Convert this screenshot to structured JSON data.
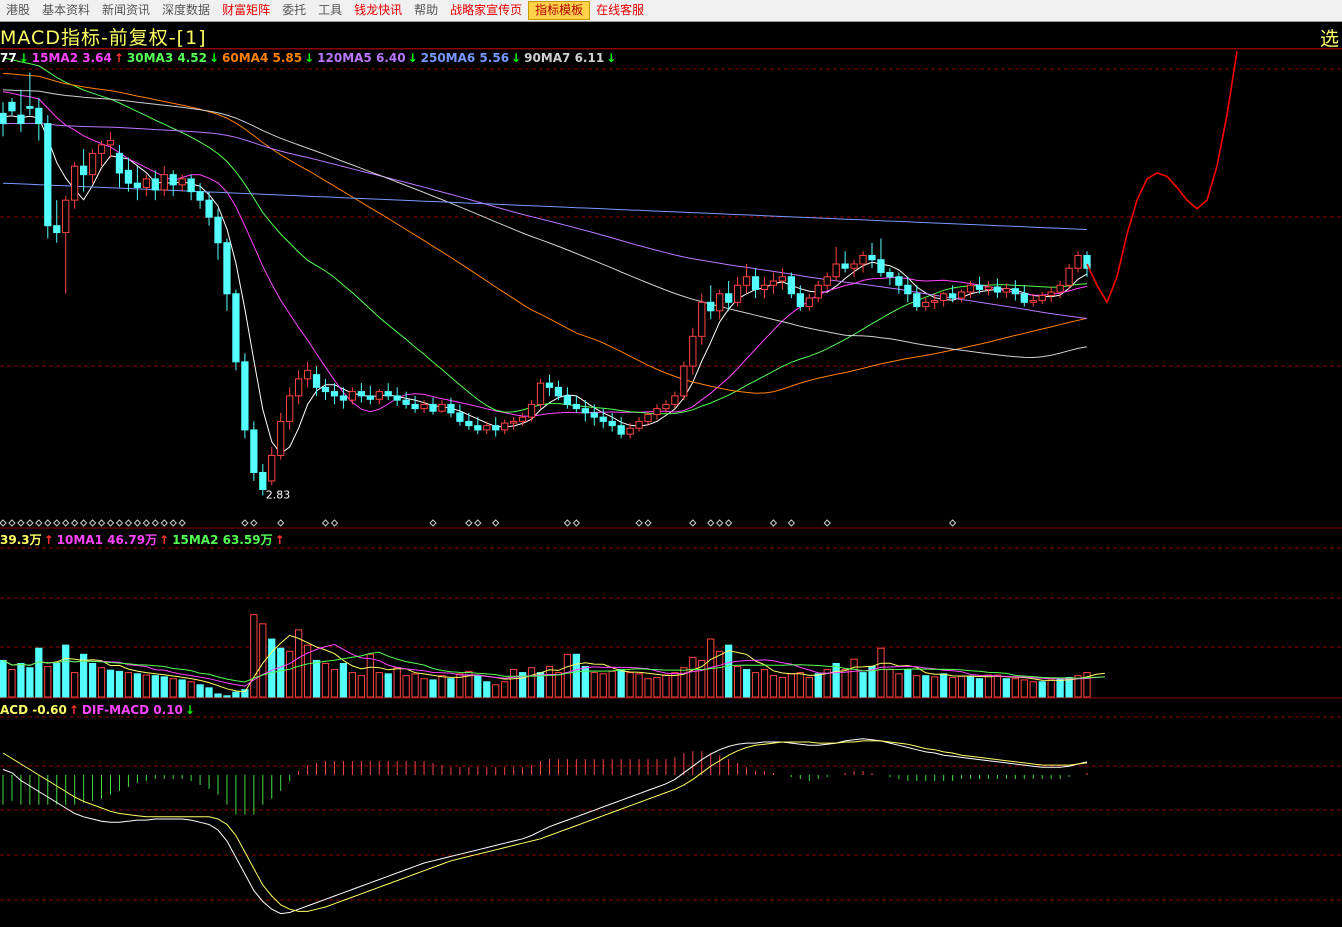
{
  "menu": [
    {
      "label": "港股",
      "style": "normal"
    },
    {
      "label": "基本资料",
      "style": "normal"
    },
    {
      "label": "新闻资讯",
      "style": "normal"
    },
    {
      "label": "深度数据",
      "style": "normal"
    },
    {
      "label": "财富矩阵",
      "style": "red"
    },
    {
      "label": "委托",
      "style": "normal"
    },
    {
      "label": "工具",
      "style": "normal"
    },
    {
      "label": "钱龙快讯",
      "style": "red"
    },
    {
      "label": "帮助",
      "style": "normal"
    },
    {
      "label": "战略家宣传页",
      "style": "red"
    },
    {
      "label": "指标模板",
      "style": "active"
    },
    {
      "label": "在线客服",
      "style": "red"
    }
  ],
  "title": "MACD指标-前复权-[1]",
  "select_label": "选",
  "ma_legend": [
    {
      "text": "77",
      "color": "#ffffff",
      "arrow": "↓",
      "arrow_color": "#00ff00"
    },
    {
      "text": "15MA2 3.64",
      "color": "#ff44ff",
      "arrow": "↑",
      "arrow_color": "#ff3333"
    },
    {
      "text": "30MA3 4.52",
      "color": "#55ff55",
      "arrow": "↓",
      "arrow_color": "#00ff00"
    },
    {
      "text": "60MA4 5.85",
      "color": "#ff8000",
      "arrow": "↓",
      "arrow_color": "#00ff00"
    },
    {
      "text": "120MA5 6.40",
      "color": "#bb77ff",
      "arrow": "↓",
      "arrow_color": "#00ff00"
    },
    {
      "text": "250MA6 5.56",
      "color": "#7799ff",
      "arrow": "↓",
      "arrow_color": "#00ff00"
    },
    {
      "text": "90MA7 6.11",
      "color": "#d0d0d0",
      "arrow": "↓",
      "arrow_color": "#00ff00"
    }
  ],
  "vol_legend": [
    {
      "text": "39.3万",
      "color": "#ffff66",
      "arrow": "↑",
      "arrow_color": "#ff3333"
    },
    {
      "text": "10MA1 46.79万",
      "color": "#ff44ff",
      "arrow": "↑",
      "arrow_color": "#ff3333"
    },
    {
      "text": "15MA2 63.59万",
      "color": "#55ff55",
      "arrow": "↑",
      "arrow_color": "#ff3333"
    }
  ],
  "macd_legend": [
    {
      "text": "ACD -0.60",
      "color": "#ffff66",
      "arrow": "↑",
      "arrow_color": "#ff3333"
    },
    {
      "text": "DIF-MACD 0.10",
      "color": "#ff44ff",
      "arrow": "↓",
      "arrow_color": "#00ff00"
    }
  ],
  "low_label": "2.83",
  "colors": {
    "up": "#ff4444",
    "down": "#54ffff",
    "grid": "#8b0000",
    "projection": "#ff0000"
  },
  "chart_data": {
    "type": "candlestick",
    "min_price": 2.83,
    "candles": [
      [
        7.32,
        7.45,
        7.2,
        7.05
      ],
      [
        7.45,
        7.5,
        7.35,
        7.3
      ],
      [
        7.3,
        7.6,
        7.2,
        7.1
      ],
      [
        7.4,
        7.8,
        7.38,
        7.3
      ],
      [
        7.38,
        7.5,
        7.2,
        7.0
      ],
      [
        7.2,
        7.3,
        6.0,
        5.85
      ],
      [
        6.0,
        6.3,
        5.92,
        5.8
      ],
      [
        5.92,
        6.35,
        6.3,
        5.2
      ],
      [
        6.3,
        6.75,
        6.7,
        6.2
      ],
      [
        6.7,
        6.9,
        6.6,
        6.4
      ],
      [
        6.6,
        6.9,
        6.85,
        6.5
      ],
      [
        6.85,
        7.0,
        6.95,
        6.7
      ],
      [
        6.95,
        7.1,
        7.0,
        6.8
      ],
      [
        6.85,
        6.95,
        6.62,
        6.45
      ],
      [
        6.65,
        6.8,
        6.5,
        6.4
      ],
      [
        6.5,
        6.7,
        6.45,
        6.3
      ],
      [
        6.45,
        6.6,
        6.55,
        6.35
      ],
      [
        6.55,
        6.65,
        6.42,
        6.3
      ],
      [
        6.42,
        6.7,
        6.6,
        6.35
      ],
      [
        6.6,
        6.65,
        6.48,
        6.35
      ],
      [
        6.48,
        6.6,
        6.55,
        6.4
      ],
      [
        6.55,
        6.6,
        6.4,
        6.3
      ],
      [
        6.4,
        6.5,
        6.3,
        6.2
      ],
      [
        6.3,
        6.4,
        6.1,
        6.0
      ],
      [
        6.1,
        6.2,
        5.8,
        5.6
      ],
      [
        5.8,
        5.85,
        5.2,
        5.0
      ],
      [
        5.2,
        5.25,
        4.4,
        4.3
      ],
      [
        4.4,
        4.5,
        3.6,
        3.5
      ],
      [
        3.6,
        3.7,
        3.1,
        3.0
      ],
      [
        3.1,
        3.2,
        2.9,
        2.83
      ],
      [
        3.0,
        3.4,
        3.3,
        2.95
      ],
      [
        3.3,
        3.8,
        3.7,
        3.25
      ],
      [
        3.7,
        4.1,
        4.0,
        3.6
      ],
      [
        4.0,
        4.3,
        4.2,
        3.9
      ],
      [
        4.2,
        4.4,
        4.3,
        4.1
      ],
      [
        4.25,
        4.35,
        4.1,
        4.0
      ],
      [
        4.1,
        4.2,
        4.05,
        3.95
      ],
      [
        4.05,
        4.15,
        4.0,
        3.9
      ],
      [
        4.0,
        4.1,
        3.95,
        3.85
      ],
      [
        3.95,
        4.1,
        4.05,
        3.9
      ],
      [
        4.05,
        4.15,
        4.0,
        3.92
      ],
      [
        4.0,
        4.12,
        3.96,
        3.9
      ],
      [
        3.96,
        4.08,
        4.05,
        3.9
      ],
      [
        4.05,
        4.15,
        4.0,
        3.95
      ],
      [
        4.0,
        4.1,
        3.95,
        3.88
      ],
      [
        3.95,
        4.05,
        3.9,
        3.85
      ],
      [
        3.9,
        4.0,
        3.85,
        3.8
      ],
      [
        3.85,
        3.95,
        3.9,
        3.8
      ],
      [
        3.9,
        3.98,
        3.82,
        3.78
      ],
      [
        3.82,
        3.95,
        3.9,
        3.8
      ],
      [
        3.9,
        3.98,
        3.8,
        3.75
      ],
      [
        3.8,
        3.9,
        3.7,
        3.65
      ],
      [
        3.7,
        3.8,
        3.65,
        3.6
      ],
      [
        3.65,
        3.75,
        3.6,
        3.55
      ],
      [
        3.6,
        3.7,
        3.65,
        3.55
      ],
      [
        3.65,
        3.75,
        3.6,
        3.52
      ],
      [
        3.6,
        3.72,
        3.68,
        3.55
      ],
      [
        3.68,
        3.75,
        3.7,
        3.6
      ],
      [
        3.7,
        3.8,
        3.75,
        3.65
      ],
      [
        3.75,
        3.95,
        3.9,
        3.7
      ],
      [
        3.9,
        4.2,
        4.15,
        3.85
      ],
      [
        4.15,
        4.25,
        4.1,
        4.0
      ],
      [
        4.1,
        4.18,
        4.0,
        3.95
      ],
      [
        4.0,
        4.1,
        3.9,
        3.85
      ],
      [
        3.9,
        4.0,
        3.85,
        3.8
      ],
      [
        3.85,
        3.95,
        3.8,
        3.7
      ],
      [
        3.8,
        3.9,
        3.75,
        3.65
      ],
      [
        3.75,
        3.85,
        3.7,
        3.62
      ],
      [
        3.7,
        3.8,
        3.65,
        3.58
      ],
      [
        3.65,
        3.75,
        3.55,
        3.5
      ],
      [
        3.55,
        3.68,
        3.62,
        3.5
      ],
      [
        3.62,
        3.75,
        3.7,
        3.58
      ],
      [
        3.7,
        3.82,
        3.78,
        3.65
      ],
      [
        3.78,
        3.9,
        3.85,
        3.72
      ],
      [
        3.85,
        3.95,
        3.9,
        3.8
      ],
      [
        3.9,
        4.05,
        4.0,
        3.85
      ],
      [
        4.0,
        4.4,
        4.35,
        3.95
      ],
      [
        4.35,
        4.8,
        4.7,
        4.25
      ],
      [
        4.7,
        5.2,
        5.1,
        4.6
      ],
      [
        5.1,
        5.3,
        5.0,
        4.9
      ],
      [
        5.0,
        5.25,
        5.2,
        4.9
      ],
      [
        5.2,
        5.35,
        5.1,
        5.0
      ],
      [
        5.1,
        5.4,
        5.3,
        5.05
      ],
      [
        5.3,
        5.55,
        5.4,
        5.2
      ],
      [
        5.4,
        5.5,
        5.25,
        5.15
      ],
      [
        5.25,
        5.4,
        5.3,
        5.15
      ],
      [
        5.3,
        5.45,
        5.35,
        5.2
      ],
      [
        5.35,
        5.5,
        5.4,
        5.25
      ],
      [
        5.4,
        5.45,
        5.2,
        5.15
      ],
      [
        5.2,
        5.3,
        5.05,
        5.0
      ],
      [
        5.05,
        5.2,
        5.15,
        5.0
      ],
      [
        5.15,
        5.35,
        5.3,
        5.1
      ],
      [
        5.3,
        5.45,
        5.4,
        5.25
      ],
      [
        5.4,
        5.75,
        5.55,
        5.35
      ],
      [
        5.55,
        5.7,
        5.5,
        5.45
      ],
      [
        5.5,
        5.6,
        5.55,
        5.4
      ],
      [
        5.55,
        5.7,
        5.65,
        5.45
      ],
      [
        5.65,
        5.8,
        5.6,
        5.5
      ],
      [
        5.6,
        5.85,
        5.45,
        5.4
      ],
      [
        5.45,
        5.5,
        5.4,
        5.3
      ],
      [
        5.4,
        5.45,
        5.3,
        5.2
      ],
      [
        5.3,
        5.4,
        5.2,
        5.1
      ],
      [
        5.2,
        5.3,
        5.05,
        5.0
      ],
      [
        5.05,
        5.15,
        5.1,
        5.0
      ],
      [
        5.1,
        5.2,
        5.12,
        5.02
      ],
      [
        5.12,
        5.22,
        5.2,
        5.05
      ],
      [
        5.2,
        5.3,
        5.15,
        5.1
      ],
      [
        5.15,
        5.25,
        5.22,
        5.1
      ],
      [
        5.22,
        5.35,
        5.3,
        5.15
      ],
      [
        5.3,
        5.4,
        5.25,
        5.2
      ],
      [
        5.25,
        5.35,
        5.28,
        5.18
      ],
      [
        5.28,
        5.38,
        5.22,
        5.15
      ],
      [
        5.22,
        5.32,
        5.26,
        5.15
      ],
      [
        5.26,
        5.36,
        5.2,
        5.12
      ],
      [
        5.2,
        5.3,
        5.1,
        5.05
      ],
      [
        5.1,
        5.2,
        5.12,
        5.05
      ],
      [
        5.12,
        5.22,
        5.18,
        5.08
      ],
      [
        5.18,
        5.28,
        5.22,
        5.1
      ],
      [
        5.22,
        5.35,
        5.3,
        5.15
      ],
      [
        5.3,
        5.55,
        5.5,
        5.25
      ],
      [
        5.5,
        5.7,
        5.65,
        5.45
      ],
      [
        5.65,
        5.7,
        5.5,
        5.4
      ]
    ],
    "projection_prices": [
      5.55,
      5.3,
      5.1,
      5.4,
      5.9,
      6.3,
      6.55,
      6.62,
      6.58,
      6.45,
      6.3,
      6.2,
      6.3,
      6.7,
      7.3,
      8.05
    ],
    "volume_max": 200,
    "volumes": [
      [
        60,
        "d"
      ],
      [
        45,
        "u"
      ],
      [
        55,
        "d"
      ],
      [
        48,
        "d"
      ],
      [
        80,
        "d"
      ],
      [
        50,
        "u"
      ],
      [
        55,
        "d"
      ],
      [
        85,
        "d"
      ],
      [
        40,
        "u"
      ],
      [
        70,
        "d"
      ],
      [
        55,
        "d"
      ],
      [
        48,
        "u"
      ],
      [
        44,
        "d"
      ],
      [
        42,
        "d"
      ],
      [
        40,
        "u"
      ],
      [
        38,
        "d"
      ],
      [
        36,
        "u"
      ],
      [
        35,
        "d"
      ],
      [
        33,
        "d"
      ],
      [
        30,
        "u"
      ],
      [
        28,
        "d"
      ],
      [
        25,
        "u"
      ],
      [
        20,
        "d"
      ],
      [
        15,
        "d"
      ],
      [
        5,
        "d"
      ],
      [
        2,
        "d"
      ],
      [
        8,
        "d"
      ],
      [
        12,
        "d"
      ],
      [
        135,
        "u"
      ],
      [
        120,
        "u"
      ],
      [
        95,
        "d"
      ],
      [
        80,
        "d"
      ],
      [
        75,
        "u"
      ],
      [
        110,
        "u"
      ],
      [
        85,
        "u"
      ],
      [
        60,
        "d"
      ],
      [
        55,
        "u"
      ],
      [
        45,
        "u"
      ],
      [
        55,
        "d"
      ],
      [
        40,
        "u"
      ],
      [
        35,
        "u"
      ],
      [
        70,
        "u"
      ],
      [
        40,
        "u"
      ],
      [
        38,
        "d"
      ],
      [
        48,
        "u"
      ],
      [
        35,
        "u"
      ],
      [
        38,
        "u"
      ],
      [
        30,
        "u"
      ],
      [
        28,
        "d"
      ],
      [
        35,
        "u"
      ],
      [
        30,
        "d"
      ],
      [
        38,
        "u"
      ],
      [
        42,
        "u"
      ],
      [
        35,
        "d"
      ],
      [
        25,
        "d"
      ],
      [
        20,
        "u"
      ],
      [
        25,
        "u"
      ],
      [
        45,
        "u"
      ],
      [
        40,
        "d"
      ],
      [
        48,
        "u"
      ],
      [
        40,
        "d"
      ],
      [
        50,
        "u"
      ],
      [
        40,
        "u"
      ],
      [
        70,
        "u"
      ],
      [
        70,
        "d"
      ],
      [
        50,
        "d"
      ],
      [
        40,
        "u"
      ],
      [
        38,
        "u"
      ],
      [
        42,
        "u"
      ],
      [
        45,
        "d"
      ],
      [
        40,
        "u"
      ],
      [
        38,
        "u"
      ],
      [
        30,
        "u"
      ],
      [
        32,
        "u"
      ],
      [
        36,
        "u"
      ],
      [
        40,
        "u"
      ],
      [
        48,
        "u"
      ],
      [
        65,
        "u"
      ],
      [
        60,
        "u"
      ],
      [
        95,
        "u"
      ],
      [
        75,
        "u"
      ],
      [
        85,
        "d"
      ],
      [
        50,
        "u"
      ],
      [
        45,
        "d"
      ],
      [
        40,
        "u"
      ],
      [
        45,
        "u"
      ],
      [
        35,
        "u"
      ],
      [
        32,
        "u"
      ],
      [
        38,
        "u"
      ],
      [
        40,
        "u"
      ],
      [
        32,
        "u"
      ],
      [
        38,
        "d"
      ],
      [
        45,
        "u"
      ],
      [
        55,
        "d"
      ],
      [
        45,
        "u"
      ],
      [
        62,
        "u"
      ],
      [
        40,
        "d"
      ],
      [
        50,
        "d"
      ],
      [
        80,
        "u"
      ],
      [
        45,
        "u"
      ],
      [
        38,
        "u"
      ],
      [
        45,
        "d"
      ],
      [
        35,
        "u"
      ],
      [
        35,
        "d"
      ],
      [
        33,
        "u"
      ],
      [
        38,
        "d"
      ],
      [
        32,
        "u"
      ],
      [
        34,
        "u"
      ],
      [
        34,
        "d"
      ],
      [
        30,
        "d"
      ],
      [
        36,
        "u"
      ],
      [
        36,
        "u"
      ],
      [
        30,
        "d"
      ],
      [
        30,
        "u"
      ],
      [
        28,
        "u"
      ],
      [
        25,
        "u"
      ],
      [
        25,
        "d"
      ],
      [
        28,
        "u"
      ],
      [
        30,
        "d"
      ],
      [
        32,
        "d"
      ],
      [
        35,
        "u"
      ],
      [
        40,
        "u"
      ],
      [
        48,
        "u"
      ],
      [
        40,
        "d"
      ]
    ],
    "dif": [
      0.05,
      0.02,
      -0.05,
      -0.1,
      -0.15,
      -0.2,
      -0.25,
      -0.3,
      -0.35,
      -0.38,
      -0.4,
      -0.42,
      -0.43,
      -0.43,
      -0.42,
      -0.41,
      -0.41,
      -0.4,
      -0.4,
      -0.4,
      -0.4,
      -0.41,
      -0.43,
      -0.45,
      -0.5,
      -0.6,
      -0.75,
      -0.9,
      -1.05,
      -1.15,
      -1.22,
      -1.26,
      -1.25,
      -1.22,
      -1.19,
      -1.16,
      -1.13,
      -1.1,
      -1.07,
      -1.04,
      -1.01,
      -0.98,
      -0.95,
      -0.92,
      -0.89,
      -0.86,
      -0.83,
      -0.8,
      -0.78,
      -0.76,
      -0.74,
      -0.72,
      -0.7,
      -0.68,
      -0.66,
      -0.64,
      -0.62,
      -0.6,
      -0.58,
      -0.55,
      -0.51,
      -0.47,
      -0.44,
      -0.41,
      -0.38,
      -0.35,
      -0.32,
      -0.29,
      -0.26,
      -0.23,
      -0.2,
      -0.17,
      -0.14,
      -0.11,
      -0.08,
      -0.04,
      0.02,
      0.08,
      0.14,
      0.19,
      0.23,
      0.26,
      0.28,
      0.29,
      0.29,
      0.3,
      0.3,
      0.3,
      0.29,
      0.28,
      0.27,
      0.27,
      0.28,
      0.29,
      0.31,
      0.32,
      0.33,
      0.32,
      0.31,
      0.29,
      0.27,
      0.25,
      0.23,
      0.21,
      0.2,
      0.18,
      0.17,
      0.16,
      0.15,
      0.14,
      0.13,
      0.12,
      0.11,
      0.1,
      0.09,
      0.08,
      0.07,
      0.07,
      0.07,
      0.08,
      0.1,
      0.12
    ],
    "dea": [
      0.2,
      0.15,
      0.1,
      0.05,
      0.0,
      -0.05,
      -0.1,
      -0.15,
      -0.2,
      -0.24,
      -0.27,
      -0.3,
      -0.33,
      -0.35,
      -0.36,
      -0.37,
      -0.38,
      -0.38,
      -0.38,
      -0.38,
      -0.38,
      -0.38,
      -0.38,
      -0.38,
      -0.4,
      -0.45,
      -0.55,
      -0.7,
      -0.85,
      -1.0,
      -1.1,
      -1.18,
      -1.22,
      -1.24,
      -1.24,
      -1.22,
      -1.2,
      -1.17,
      -1.14,
      -1.11,
      -1.08,
      -1.05,
      -1.02,
      -0.99,
      -0.96,
      -0.93,
      -0.9,
      -0.87,
      -0.84,
      -0.81,
      -0.78,
      -0.76,
      -0.74,
      -0.72,
      -0.7,
      -0.68,
      -0.66,
      -0.64,
      -0.62,
      -0.6,
      -0.58,
      -0.55,
      -0.52,
      -0.49,
      -0.46,
      -0.43,
      -0.4,
      -0.37,
      -0.34,
      -0.31,
      -0.28,
      -0.25,
      -0.22,
      -0.19,
      -0.16,
      -0.13,
      -0.09,
      -0.04,
      0.02,
      0.08,
      0.13,
      0.18,
      0.22,
      0.25,
      0.27,
      0.28,
      0.29,
      0.3,
      0.3,
      0.3,
      0.3,
      0.29,
      0.29,
      0.29,
      0.3,
      0.3,
      0.31,
      0.31,
      0.31,
      0.3,
      0.29,
      0.28,
      0.26,
      0.24,
      0.23,
      0.21,
      0.2,
      0.18,
      0.17,
      0.16,
      0.15,
      0.14,
      0.13,
      0.12,
      0.11,
      0.1,
      0.09,
      0.09,
      0.09,
      0.09,
      0.1,
      0.11
    ]
  }
}
